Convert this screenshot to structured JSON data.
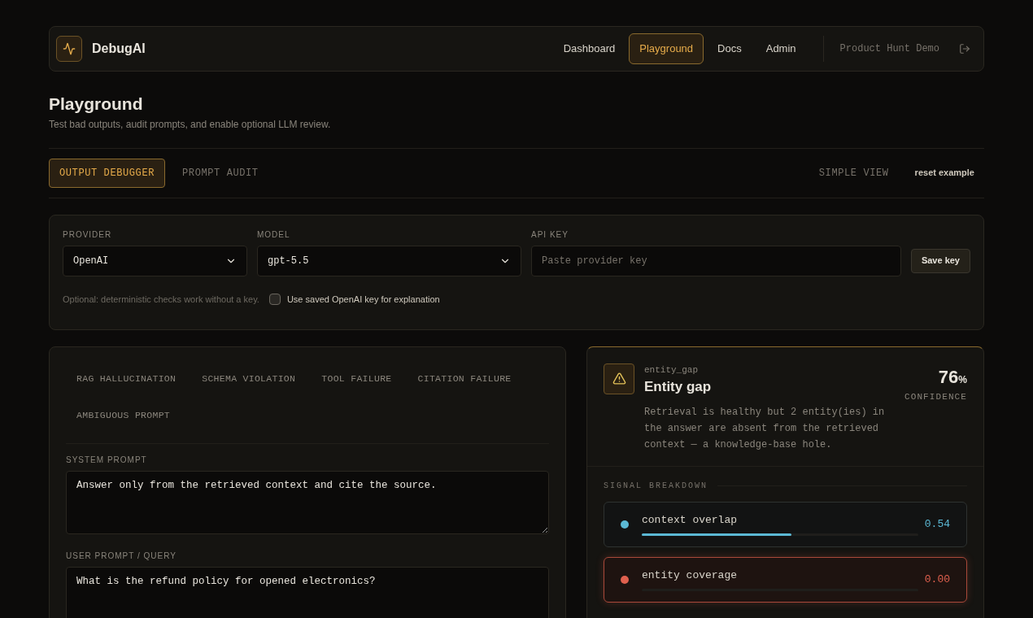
{
  "brand": {
    "name": "DebugAI"
  },
  "nav": [
    {
      "label": "Dashboard",
      "selected": false
    },
    {
      "label": "Playground",
      "selected": true
    },
    {
      "label": "Docs",
      "selected": false
    },
    {
      "label": "Admin",
      "selected": false
    }
  ],
  "user": {
    "label": "Product Hunt Demo"
  },
  "page": {
    "title": "Playground",
    "subtitle": "Test bad outputs, audit prompts, and enable optional LLM review."
  },
  "modes": [
    {
      "label": "OUTPUT DEBUGGER",
      "selected": true
    },
    {
      "label": "PROMPT AUDIT",
      "selected": false
    }
  ],
  "view_toggle": "SIMPLE VIEW",
  "reset": "reset example",
  "config": {
    "provider": {
      "label": "PROVIDER",
      "value": "OpenAI"
    },
    "model": {
      "label": "MODEL",
      "value": "gpt-5.5"
    },
    "api_key": {
      "label": "API KEY",
      "placeholder": "Paste provider key"
    },
    "save": "Save key",
    "note": "Optional: deterministic checks work without a key.",
    "use_saved": {
      "label": "Use saved OpenAI key for explanation",
      "checked": false
    }
  },
  "scenarios": [
    {
      "label": "RAG HALLUCINATION",
      "selected": false
    },
    {
      "label": "SCHEMA VIOLATION",
      "selected": false
    },
    {
      "label": "TOOL FAILURE",
      "selected": false
    },
    {
      "label": "CITATION FAILURE",
      "selected": false
    },
    {
      "label": "AMBIGUOUS PROMPT",
      "selected": false
    }
  ],
  "system_prompt": {
    "label": "SYSTEM PROMPT",
    "value": "Answer only from the retrieved context and cite the source."
  },
  "user_prompt": {
    "label": "USER PROMPT / QUERY",
    "value": "What is the refund policy for opened electronics?"
  },
  "result": {
    "code": "entity_gap",
    "title": "Entity gap",
    "confidence": "76",
    "unit": "%",
    "confidence_label": "CONFIDENCE",
    "description": "Retrieval is healthy but 2 entity(ies) in the answer are absent from the retrieved context — a knowledge-base hole.",
    "breakdown_label": "SIGNAL BREAKDOWN",
    "signals": [
      {
        "name": "context overlap",
        "value": "0.54",
        "level": 0.54,
        "color": "#5bb8d4",
        "flagged": false
      },
      {
        "name": "entity coverage",
        "value": "0.00",
        "level": 0,
        "color": "#e0604e",
        "flagged": true
      }
    ]
  }
}
